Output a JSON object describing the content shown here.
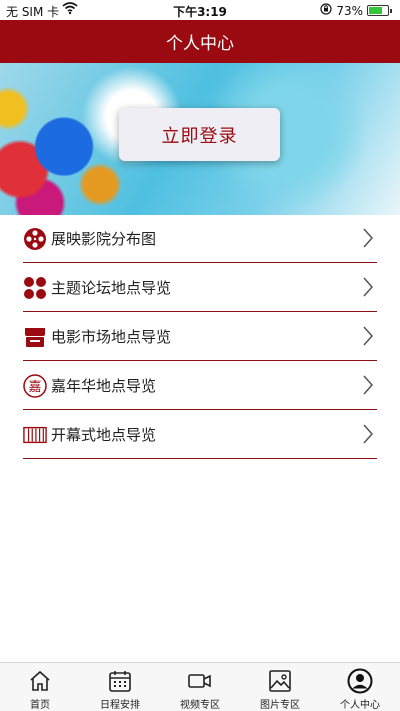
{
  "status_bar": {
    "carrier": "无 SIM 卡",
    "time": "下午3:19",
    "battery_percent": "73%",
    "battery_level": 0.73
  },
  "header": {
    "title": "个人中心"
  },
  "banner": {
    "login_label": "立即登录"
  },
  "menu": {
    "items": [
      {
        "label": "展映影院分布图",
        "icon": "film-reel-icon"
      },
      {
        "label": "主题论坛地点导览",
        "icon": "four-dots-icon"
      },
      {
        "label": "电影市场地点导览",
        "icon": "storefront-icon"
      },
      {
        "label": "嘉年华地点导览",
        "icon": "carnival-seal-icon",
        "icon_text": "嘉"
      },
      {
        "label": "开幕式地点导览",
        "icon": "stage-curtain-icon"
      }
    ]
  },
  "tab_bar": {
    "tabs": [
      {
        "label": "首页",
        "icon": "home-icon"
      },
      {
        "label": "日程安排",
        "icon": "calendar-icon"
      },
      {
        "label": "视频专区",
        "icon": "video-camera-icon"
      },
      {
        "label": "图片专区",
        "icon": "picture-icon"
      },
      {
        "label": "个人中心",
        "icon": "user-icon",
        "active": true
      }
    ]
  },
  "colors": {
    "brand_red": "#9b0a10",
    "battery_green": "#35c53a"
  }
}
